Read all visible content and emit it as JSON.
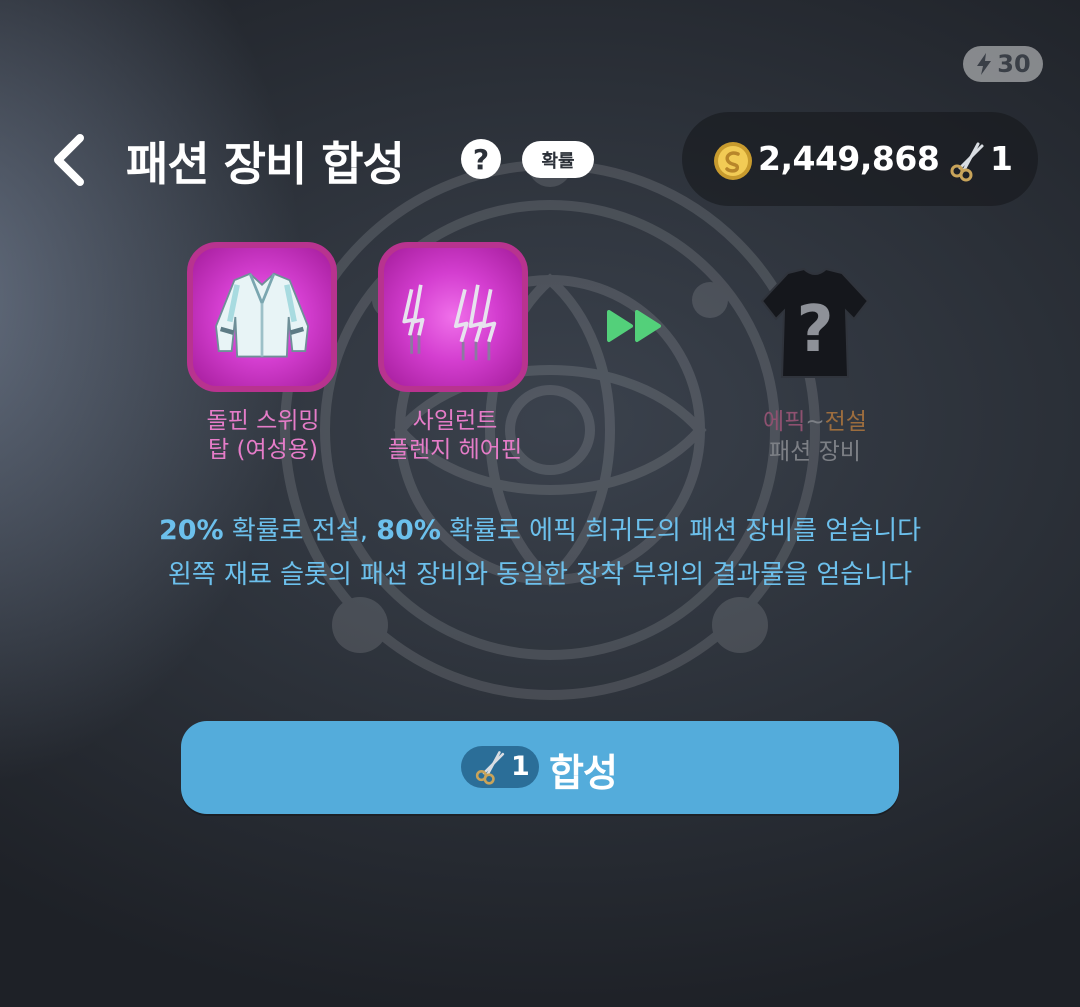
{
  "status": {
    "energy": "30"
  },
  "header": {
    "title": "패션 장비 합성",
    "help_label": "?",
    "probability_label": "확률"
  },
  "currency": {
    "gold": "2,449,868",
    "tickets": "1"
  },
  "materials": [
    {
      "name_line1": "돌핀 스위밍",
      "name_line2": "탑 (여성용)",
      "icon": "jacket-icon"
    },
    {
      "name_line1": "사일런트",
      "name_line2": "플렌지 헤어핀",
      "icon": "hairpin-icon"
    }
  ],
  "result": {
    "rarity_from": "에픽",
    "tilde": "~",
    "rarity_to": "전설",
    "subtitle": "패션 장비",
    "icon": "mystery-shirt-icon"
  },
  "description": {
    "line1_pct1": "20%",
    "line1_part1": " 확률로 전설, ",
    "line1_pct2": "80%",
    "line1_part2": " 확률로 에픽 희귀도의 패션 장비를 얻습니다",
    "line2": "왼쪽 재료 슬롯의 패션 장비와 동일한 장착 부위의 결과물을 얻습니다"
  },
  "action": {
    "cost": "1",
    "label": "합성"
  },
  "colors": {
    "accent_blue": "#54acdb",
    "desc_blue": "#6cc0ec",
    "epic_pink": "#e57cc8",
    "slot_border": "#b8338f"
  }
}
